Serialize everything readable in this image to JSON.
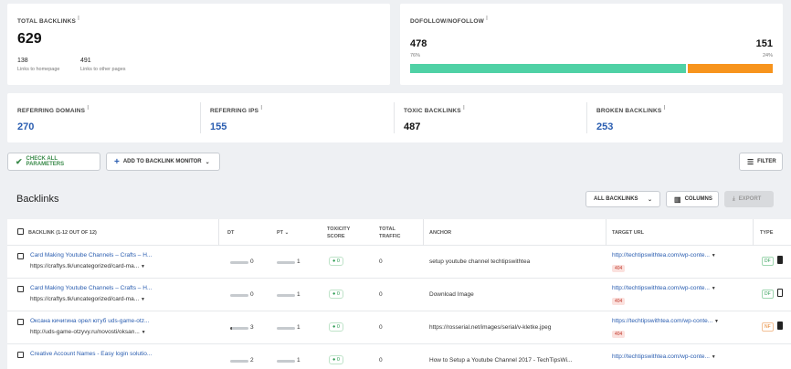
{
  "total_backlinks": {
    "label": "TOTAL BACKLINKS",
    "value": "629",
    "sub": [
      {
        "value": "138",
        "label": "Links to homepage"
      },
      {
        "value": "491",
        "label": "Links to other pages"
      }
    ]
  },
  "dofollow": {
    "label": "DOFOLLOW/NOFOLLOW",
    "dofollow_value": "478",
    "dofollow_pct": "76%",
    "nofollow_value": "151",
    "nofollow_pct": "24%",
    "dofollow_fraction": 0.76,
    "dofollow_color": "#4fd1a5",
    "nofollow_color": "#f7941d"
  },
  "metrics": [
    {
      "label": "REFERRING DOMAINS",
      "value": "270",
      "color": "blue"
    },
    {
      "label": "REFERRING IPS",
      "value": "155",
      "color": "blue"
    },
    {
      "label": "TOXIC BACKLINKS",
      "value": "487",
      "color": "black"
    },
    {
      "label": "BROKEN BACKLINKS",
      "value": "253",
      "color": "blue"
    }
  ],
  "toolbar": {
    "check_all": "CHECK ALL PARAMETERS",
    "add_monitor": "ADD TO BACKLINK MONITOR",
    "filter": "FILTER"
  },
  "backlinks": {
    "title": "Backlinks",
    "dropdown": "ALL BACKLINKS",
    "columns": "COLUMNS",
    "export": "EXPORT",
    "headers": {
      "backlink": "BACKLINK (1-12 OUT OF 12)",
      "dt": "DT",
      "pt": "PT",
      "toxicity": "TOXICITY SCORE",
      "traffic": "TOTAL TRAFFIC",
      "anchor": "ANCHOR",
      "target": "TARGET URL",
      "type": "TYPE"
    },
    "rows": [
      {
        "title": "Card Making Youtube Channels – Crafts – H...",
        "url": "https://craftys.tk/uncategorized/card-ma...",
        "dt": "0",
        "pt": "1",
        "tox": "0",
        "traffic": "0",
        "anchor": "setup youtube channel techtipswithtea",
        "target": "http://techtipswithtea.com/wp-conte...",
        "target_badge": "404",
        "type": "DF",
        "type_color": "#2a9a50"
      },
      {
        "title": "Card Making Youtube Channels – Crafts – H...",
        "url": "https://craftys.tk/uncategorized/card-ma...",
        "dt": "0",
        "pt": "1",
        "tox": "0",
        "traffic": "0",
        "anchor": "Download Image",
        "target": "http://techtipswithtea.com/wp-conte...",
        "target_badge": "404",
        "type": "DF",
        "type_color": "#2a9a50"
      },
      {
        "title": "Оксана кичигина орел ютуб uds-game-otz...",
        "url": "http://uds-game-otzyvy.ru/novosti/oksan...",
        "dt": "3",
        "pt": "1",
        "tox": "0",
        "traffic": "0",
        "anchor": "https://rosserial.net/images/serial/v-kletke.jpeg",
        "target": "https://techtipswithtea.com/wp-conte...",
        "target_badge": "404",
        "type": "NF",
        "type_color": "#e67e22"
      },
      {
        "title": "Creative Account Names - Easy login solutio...",
        "url": "",
        "dt": "2",
        "pt": "1",
        "tox": "0",
        "traffic": "0",
        "anchor": "How to Setup a Youtube Channel 2017 - TechTipsWi...",
        "target": "http://techtipswithtea.com/wp-conte...",
        "target_badge": "",
        "type": "",
        "type_color": "#2a9a50"
      }
    ]
  }
}
